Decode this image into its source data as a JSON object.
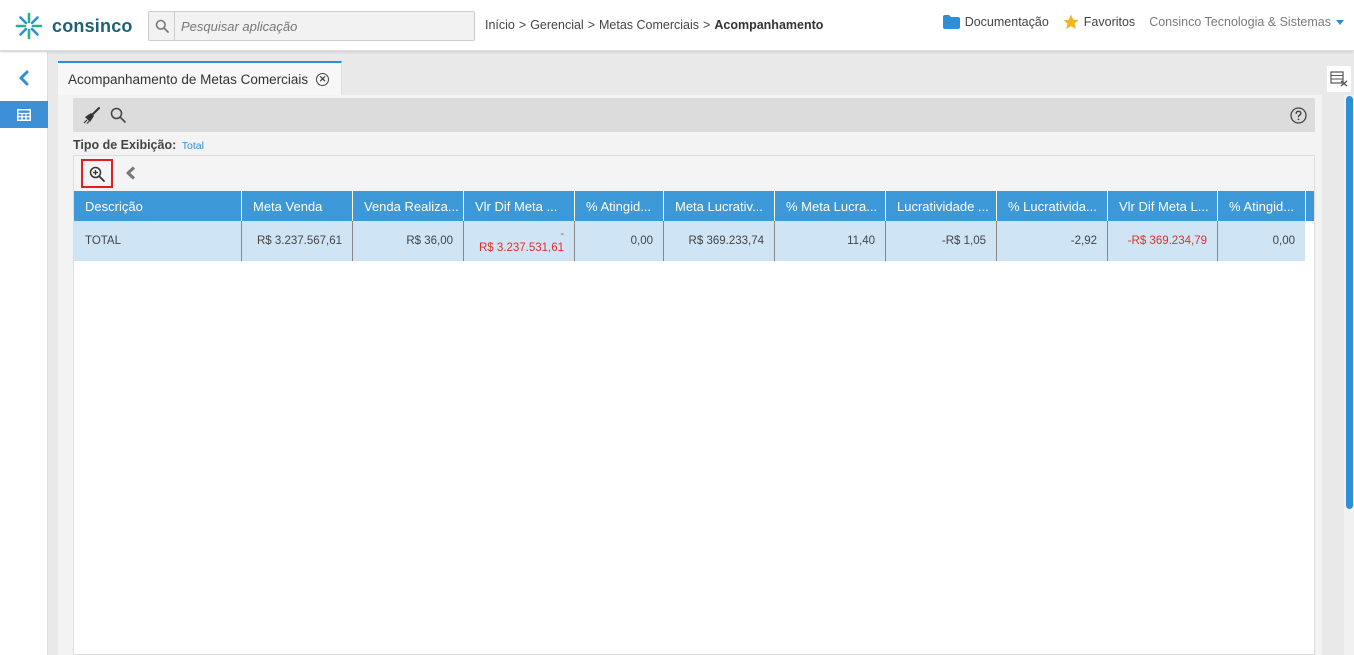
{
  "app": {
    "logo_text": "consinco",
    "search_placeholder": "Pesquisar aplicação",
    "breadcrumb": [
      "Início",
      "Gerencial",
      "Metas Comerciais",
      "Acompanhamento"
    ],
    "breadcrumb_sep": ">",
    "documentation_label": "Documentação",
    "favorites_label": "Favoritos",
    "company_label": "Consinco Tecnologia & Sistemas"
  },
  "tab": {
    "title": "Acompanhamento de Metas Comerciais"
  },
  "filter": {
    "label": "Tipo de Exibição:",
    "value": "Total"
  },
  "grid": {
    "columns": [
      "Descrição",
      "Meta Venda",
      "Venda Realiza...",
      "Vlr Dif Meta ...",
      "% Atingid...",
      "Meta Lucrativ...",
      "% Meta Lucra...",
      "Lucratividade ...",
      "% Lucrativida...",
      "Vlr Dif Meta L...",
      "% Atingid..."
    ],
    "row": {
      "descricao": "TOTAL",
      "meta_venda": "R$ 3.237.567,61",
      "venda_realizada": "R$ 36,00",
      "vlr_dif_meta_dash": "-",
      "vlr_dif_meta": "R$ 3.237.531,61",
      "pct_atingido": "0,00",
      "meta_lucratividade": "R$ 369.233,74",
      "pct_meta_lucra": "11,40",
      "lucratividade": "-R$ 1,05",
      "pct_lucratividade": "-2,92",
      "vlr_dif_meta_l": "-R$ 369.234,79",
      "pct_atingido_2": "0,00"
    }
  },
  "colors": {
    "accent": "#2d8fd6",
    "header_bg": "#3d98d8",
    "row_bg": "#cfe5f5",
    "negative": "#e0302a",
    "highlight": "#e02020"
  },
  "icons": [
    "consinco-logo-icon",
    "search-icon",
    "folder-icon",
    "star-icon",
    "chevron-left-icon",
    "table-icon",
    "close-circle-icon",
    "broom-icon",
    "search-icon",
    "help-icon",
    "zoom-in-icon",
    "chevron-left-icon",
    "grid-settings-icon"
  ]
}
